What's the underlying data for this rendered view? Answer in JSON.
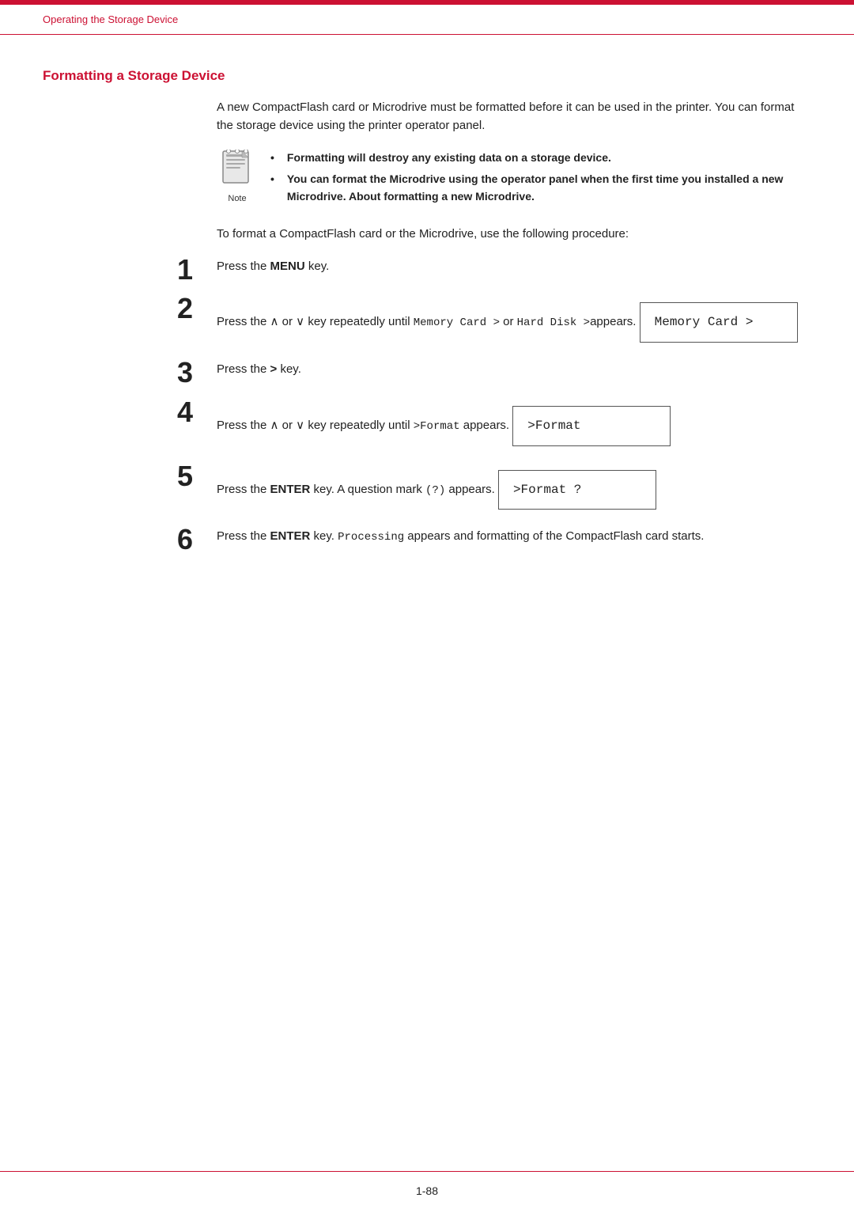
{
  "header": {
    "breadcrumb": "Operating the Storage Device"
  },
  "section": {
    "title": "Formatting a Storage Device"
  },
  "intro": {
    "text": "A new CompactFlash card or Microdrive must be formatted before it can be used in the printer. You can format the storage device using the printer operator panel."
  },
  "notes": [
    "Formatting will destroy any existing data on a storage device.",
    "You can format the Microdrive using the operator panel when the first time you installed a new Microdrive. About formatting a new Microdrive."
  ],
  "note_label": "Note",
  "procedure_intro": "To format a CompactFlash card or the Microdrive, use the following procedure:",
  "steps": [
    {
      "number": "1",
      "text": "Press the ",
      "bold": "MENU",
      "text2": " key."
    },
    {
      "number": "2",
      "text_before": "Press the ∧ or ∨ key repeatedly until ",
      "code1": "Memory Card >",
      "text_mid": " or ",
      "code2": "Hard Disk >",
      "text_after": "appears."
    },
    {
      "number": "3",
      "text": "Press the > key."
    },
    {
      "number": "4",
      "text_before": "Press the ∧ or ∨ key repeatedly until ",
      "code1": ">Format",
      "text_after": " appears."
    },
    {
      "number": "5",
      "text_before": "Press the ",
      "bold": "ENTER",
      "text_after": " key. A question mark ",
      "code1": "(?)",
      "text_end": " appears."
    },
    {
      "number": "6",
      "text_before": "Press the ",
      "bold": "ENTER",
      "text_after": " key. ",
      "code1": "Processing",
      "text_end": " appears and formatting of the CompactFlash card starts."
    }
  ],
  "lcd_boxes": {
    "step2": "Memory Card   >",
    "step4": ">Format",
    "step5": ">Format ?"
  },
  "page_number": "1-88"
}
